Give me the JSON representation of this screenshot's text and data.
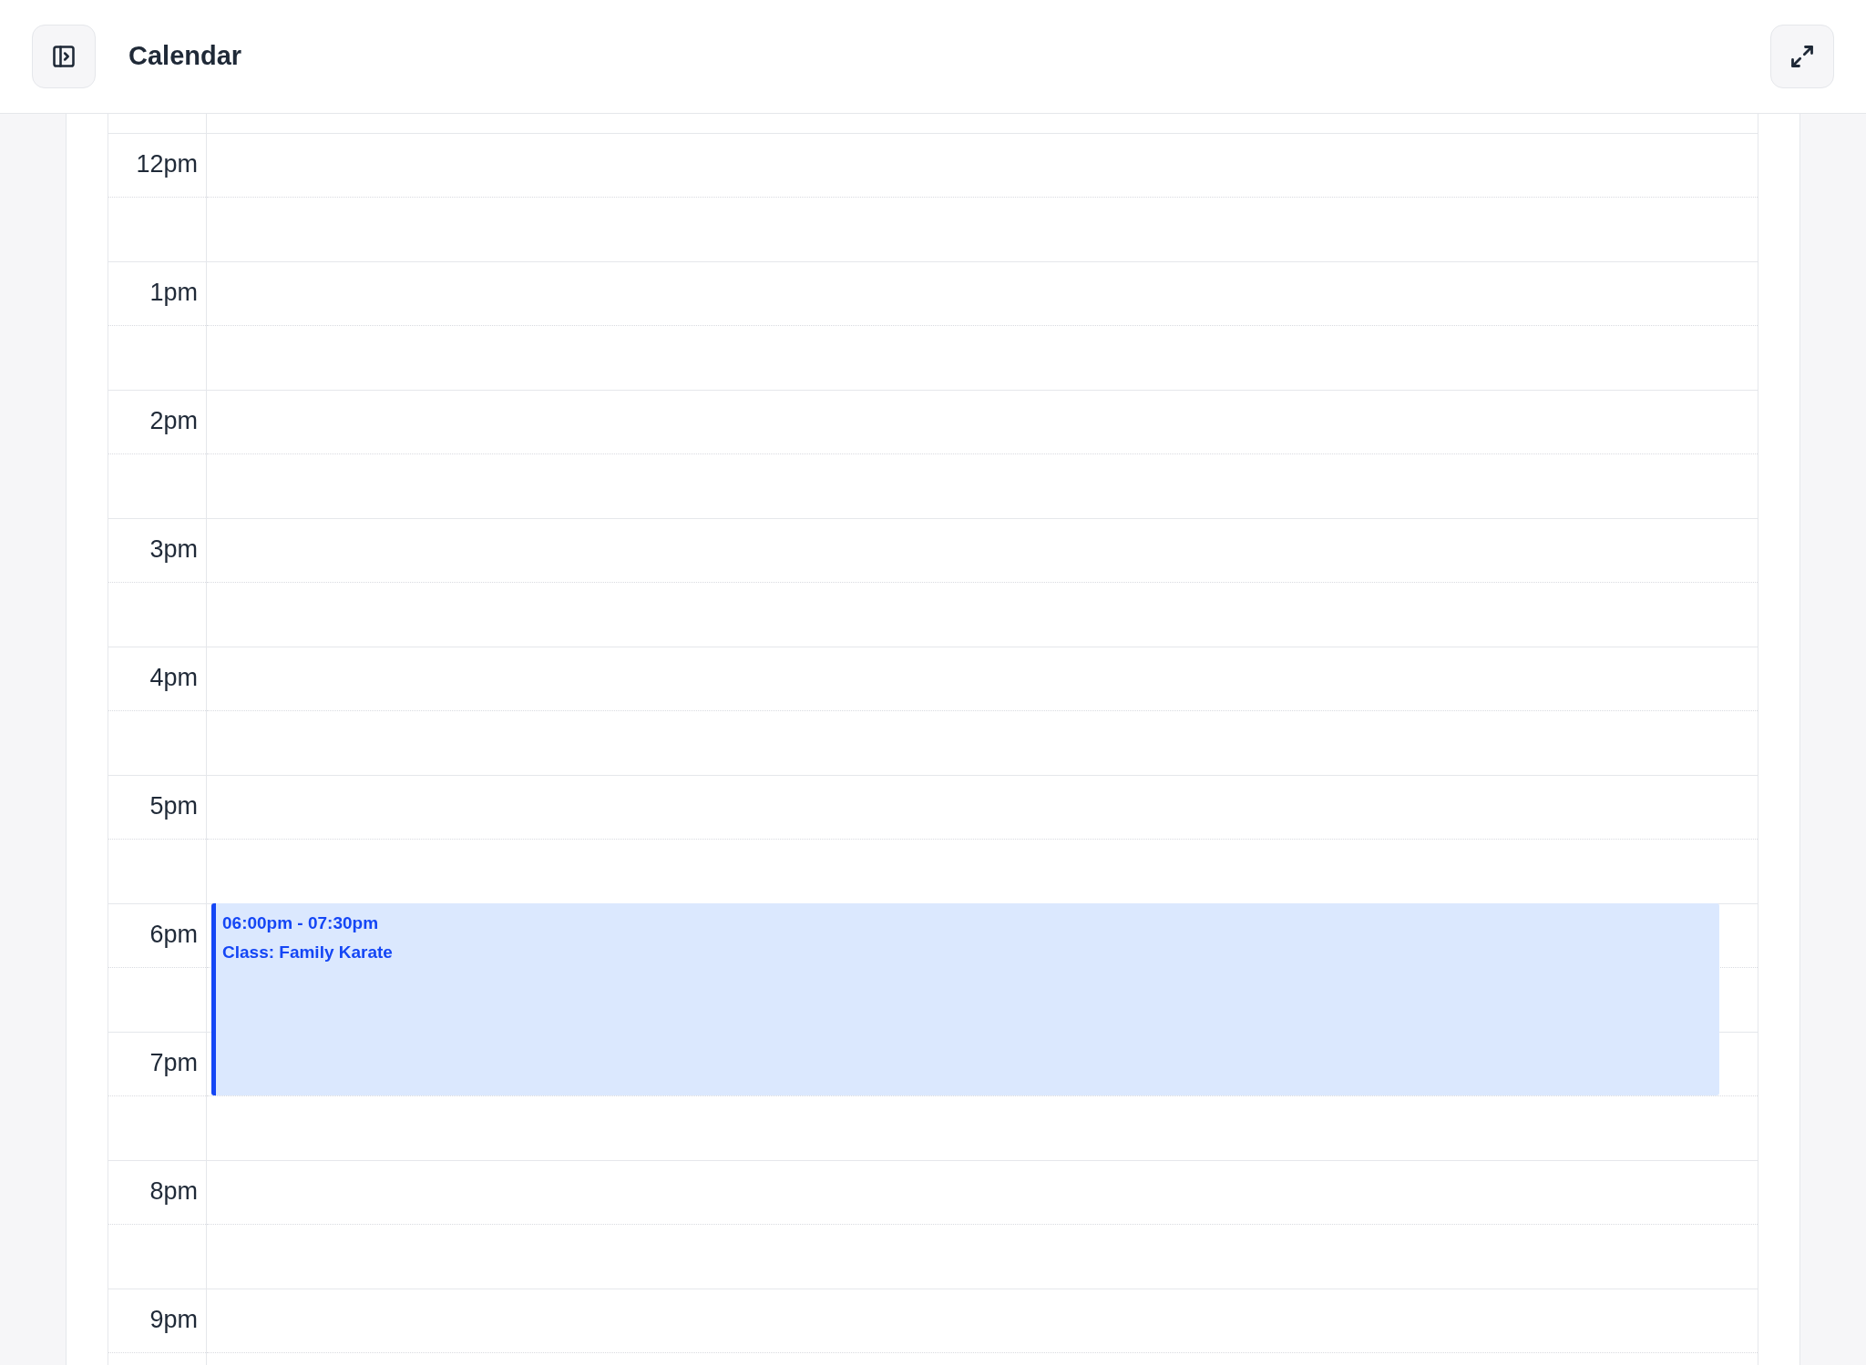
{
  "header": {
    "title": "Calendar"
  },
  "hours": [
    {
      "label": "12pm"
    },
    {
      "label": "1pm"
    },
    {
      "label": "2pm"
    },
    {
      "label": "3pm"
    },
    {
      "label": "4pm"
    },
    {
      "label": "5pm"
    },
    {
      "label": "6pm",
      "events": [
        {
          "time": "06:00pm - 07:30pm",
          "title": "Class: Family Karate"
        }
      ]
    },
    {
      "label": "7pm"
    },
    {
      "label": "8pm"
    },
    {
      "label": "9pm"
    }
  ]
}
